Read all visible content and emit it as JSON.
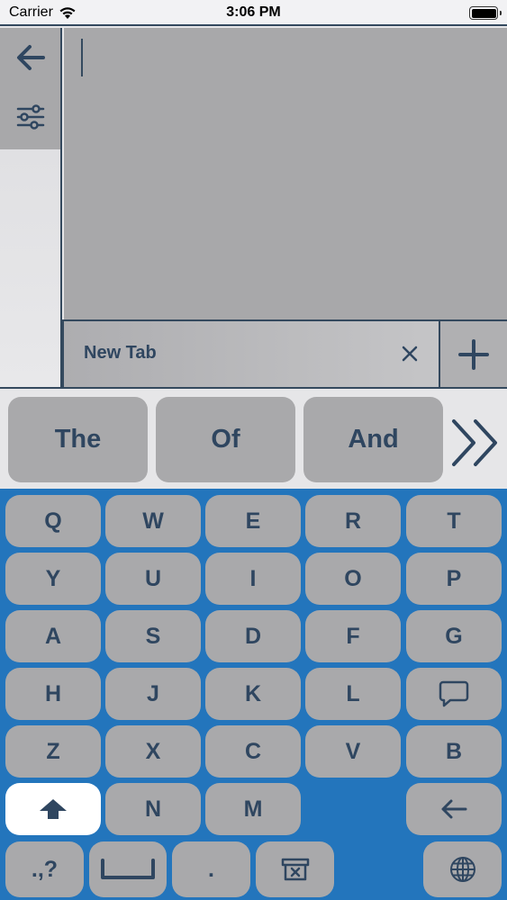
{
  "status_bar": {
    "carrier": "Carrier",
    "time": "3:06 PM"
  },
  "toolbar": {
    "back_icon": "arrow-left-icon",
    "settings_icon": "sliders-icon"
  },
  "editor": {
    "text": ""
  },
  "tabs": [
    {
      "label": "New Tab"
    }
  ],
  "add_tab_icon": "plus-icon",
  "suggestions": [
    "The",
    "Of",
    "And"
  ],
  "suggestions_more_icon": "double-chevron-right-icon",
  "keyboard": {
    "rows": [
      [
        "Q",
        "W",
        "E",
        "R",
        "T"
      ],
      [
        "Y",
        "U",
        "I",
        "O",
        "P"
      ],
      [
        "A",
        "S",
        "D",
        "F",
        "G"
      ],
      [
        "H",
        "J",
        "K",
        "L",
        "speech-bubble-icon"
      ],
      [
        "Z",
        "X",
        "C",
        "V",
        "B"
      ],
      [
        "shift-icon",
        "N",
        "M",
        "",
        "backspace-arrow-icon"
      ]
    ],
    "bottom_row": {
      "punct": ".,?",
      "space_icon": "space-bar-icon",
      "period": ".",
      "clear_icon": "clear-box-icon",
      "globe_icon": "globe-icon"
    }
  },
  "colors": {
    "accent_dark": "#2f4660",
    "keyboard_bg": "#2375bc",
    "key_bg": "#a9a9ab",
    "panel_gray": "#a8a8aa",
    "shift_key_bg": "#ffffff"
  }
}
